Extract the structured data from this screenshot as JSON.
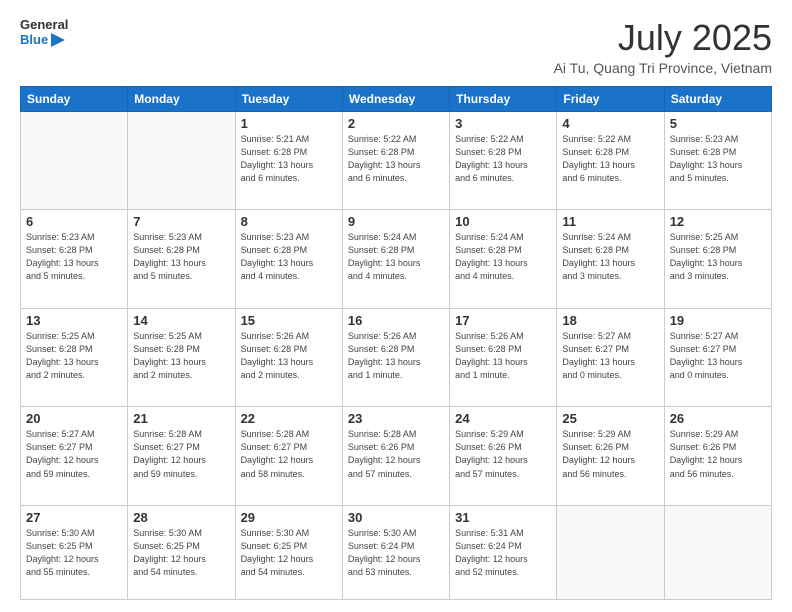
{
  "logo": {
    "line1": "General",
    "line2": "Blue"
  },
  "title": "July 2025",
  "location": "Ai Tu, Quang Tri Province, Vietnam",
  "weekdays": [
    "Sunday",
    "Monday",
    "Tuesday",
    "Wednesday",
    "Thursday",
    "Friday",
    "Saturday"
  ],
  "weeks": [
    [
      {
        "day": "",
        "info": ""
      },
      {
        "day": "",
        "info": ""
      },
      {
        "day": "1",
        "info": "Sunrise: 5:21 AM\nSunset: 6:28 PM\nDaylight: 13 hours\nand 6 minutes."
      },
      {
        "day": "2",
        "info": "Sunrise: 5:22 AM\nSunset: 6:28 PM\nDaylight: 13 hours\nand 6 minutes."
      },
      {
        "day": "3",
        "info": "Sunrise: 5:22 AM\nSunset: 6:28 PM\nDaylight: 13 hours\nand 6 minutes."
      },
      {
        "day": "4",
        "info": "Sunrise: 5:22 AM\nSunset: 6:28 PM\nDaylight: 13 hours\nand 6 minutes."
      },
      {
        "day": "5",
        "info": "Sunrise: 5:23 AM\nSunset: 6:28 PM\nDaylight: 13 hours\nand 5 minutes."
      }
    ],
    [
      {
        "day": "6",
        "info": "Sunrise: 5:23 AM\nSunset: 6:28 PM\nDaylight: 13 hours\nand 5 minutes."
      },
      {
        "day": "7",
        "info": "Sunrise: 5:23 AM\nSunset: 6:28 PM\nDaylight: 13 hours\nand 5 minutes."
      },
      {
        "day": "8",
        "info": "Sunrise: 5:23 AM\nSunset: 6:28 PM\nDaylight: 13 hours\nand 4 minutes."
      },
      {
        "day": "9",
        "info": "Sunrise: 5:24 AM\nSunset: 6:28 PM\nDaylight: 13 hours\nand 4 minutes."
      },
      {
        "day": "10",
        "info": "Sunrise: 5:24 AM\nSunset: 6:28 PM\nDaylight: 13 hours\nand 4 minutes."
      },
      {
        "day": "11",
        "info": "Sunrise: 5:24 AM\nSunset: 6:28 PM\nDaylight: 13 hours\nand 3 minutes."
      },
      {
        "day": "12",
        "info": "Sunrise: 5:25 AM\nSunset: 6:28 PM\nDaylight: 13 hours\nand 3 minutes."
      }
    ],
    [
      {
        "day": "13",
        "info": "Sunrise: 5:25 AM\nSunset: 6:28 PM\nDaylight: 13 hours\nand 2 minutes."
      },
      {
        "day": "14",
        "info": "Sunrise: 5:25 AM\nSunset: 6:28 PM\nDaylight: 13 hours\nand 2 minutes."
      },
      {
        "day": "15",
        "info": "Sunrise: 5:26 AM\nSunset: 6:28 PM\nDaylight: 13 hours\nand 2 minutes."
      },
      {
        "day": "16",
        "info": "Sunrise: 5:26 AM\nSunset: 6:28 PM\nDaylight: 13 hours\nand 1 minute."
      },
      {
        "day": "17",
        "info": "Sunrise: 5:26 AM\nSunset: 6:28 PM\nDaylight: 13 hours\nand 1 minute."
      },
      {
        "day": "18",
        "info": "Sunrise: 5:27 AM\nSunset: 6:27 PM\nDaylight: 13 hours\nand 0 minutes."
      },
      {
        "day": "19",
        "info": "Sunrise: 5:27 AM\nSunset: 6:27 PM\nDaylight: 13 hours\nand 0 minutes."
      }
    ],
    [
      {
        "day": "20",
        "info": "Sunrise: 5:27 AM\nSunset: 6:27 PM\nDaylight: 12 hours\nand 59 minutes."
      },
      {
        "day": "21",
        "info": "Sunrise: 5:28 AM\nSunset: 6:27 PM\nDaylight: 12 hours\nand 59 minutes."
      },
      {
        "day": "22",
        "info": "Sunrise: 5:28 AM\nSunset: 6:27 PM\nDaylight: 12 hours\nand 58 minutes."
      },
      {
        "day": "23",
        "info": "Sunrise: 5:28 AM\nSunset: 6:26 PM\nDaylight: 12 hours\nand 57 minutes."
      },
      {
        "day": "24",
        "info": "Sunrise: 5:29 AM\nSunset: 6:26 PM\nDaylight: 12 hours\nand 57 minutes."
      },
      {
        "day": "25",
        "info": "Sunrise: 5:29 AM\nSunset: 6:26 PM\nDaylight: 12 hours\nand 56 minutes."
      },
      {
        "day": "26",
        "info": "Sunrise: 5:29 AM\nSunset: 6:26 PM\nDaylight: 12 hours\nand 56 minutes."
      }
    ],
    [
      {
        "day": "27",
        "info": "Sunrise: 5:30 AM\nSunset: 6:25 PM\nDaylight: 12 hours\nand 55 minutes."
      },
      {
        "day": "28",
        "info": "Sunrise: 5:30 AM\nSunset: 6:25 PM\nDaylight: 12 hours\nand 54 minutes."
      },
      {
        "day": "29",
        "info": "Sunrise: 5:30 AM\nSunset: 6:25 PM\nDaylight: 12 hours\nand 54 minutes."
      },
      {
        "day": "30",
        "info": "Sunrise: 5:30 AM\nSunset: 6:24 PM\nDaylight: 12 hours\nand 53 minutes."
      },
      {
        "day": "31",
        "info": "Sunrise: 5:31 AM\nSunset: 6:24 PM\nDaylight: 12 hours\nand 52 minutes."
      },
      {
        "day": "",
        "info": ""
      },
      {
        "day": "",
        "info": ""
      }
    ]
  ]
}
